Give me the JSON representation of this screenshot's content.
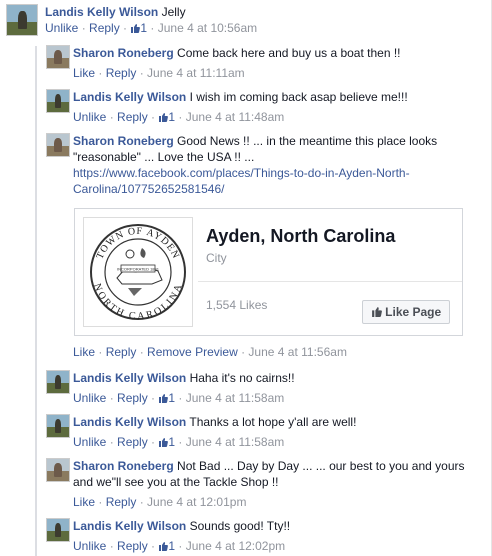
{
  "comments": [
    {
      "name": "Landis Kelly Wilson",
      "text": "Jelly",
      "action": "Unlike",
      "reply": "Reply",
      "likes": "1",
      "time": "June 4 at 10:56am"
    },
    {
      "name": "Sharon Roneberg",
      "text": "Come back here and buy us a boat then !!",
      "action": "Like",
      "reply": "Reply",
      "time": "June 4 at 11:11am"
    },
    {
      "name": "Landis Kelly Wilson",
      "text": "I wish im coming back asap believe me!!!",
      "action": "Unlike",
      "reply": "Reply",
      "likes": "1",
      "time": "June 4 at 11:48am"
    },
    {
      "name": "Sharon Roneberg",
      "text_line1": "Good News !! ... in the meantime this place looks",
      "text_line2": "\"reasonable\" ... Love the USA !! ...",
      "link_line1": "https://www.facebook.com/places/Things-to-do-in-Ayden-North-",
      "link_line2": "Carolina/107752652581546/",
      "action": "Like",
      "reply": "Reply",
      "remove_preview": "Remove Preview",
      "time": "June 4 at 11:56am"
    },
    {
      "name": "Landis Kelly Wilson",
      "text": "Haha it's no cairns!!",
      "action": "Unlike",
      "reply": "Reply",
      "likes": "1",
      "time": "June 4 at 11:58am"
    },
    {
      "name": "Landis Kelly Wilson",
      "text": "Thanks a lot hope y'all are well!",
      "action": "Unlike",
      "reply": "Reply",
      "likes": "1",
      "time": "June 4 at 11:58am"
    },
    {
      "name": "Sharon Roneberg",
      "text_line1": "Not Bad ... Day by Day ... ... our best to you and yours",
      "text_line2": "and we\"ll see you at the Tackle Shop !!",
      "action": "Like",
      "reply": "Reply",
      "time": "June 4 at 12:01pm"
    },
    {
      "name": "Landis Kelly Wilson",
      "text": "Sounds good! Tty!!",
      "action": "Unlike",
      "reply": "Reply",
      "likes": "1",
      "time": "June 4 at 12:02pm"
    }
  ],
  "card": {
    "title": "Ayden, North Carolina",
    "subtitle": "City",
    "likes": "1,554 Likes",
    "like_button": "Like Page",
    "seal_top": "TOWN OF AYDEN",
    "seal_bottom": "NORTH CAROLINA",
    "seal_banner": "INCORPORATED 1891"
  },
  "colors": {
    "link": "#3b5998",
    "meta": "#90949c"
  }
}
